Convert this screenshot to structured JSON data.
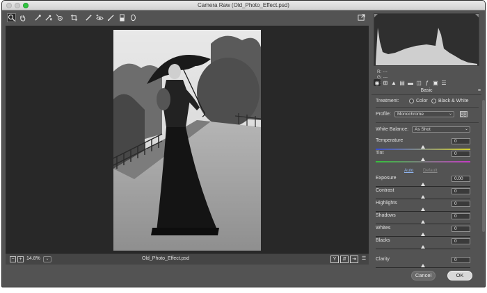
{
  "window": {
    "title": "Camera Raw (Old_Photo_Effect.psd)"
  },
  "toolbar": {
    "tools": [
      "zoom-icon",
      "hand-icon",
      "white-balance-icon",
      "color-sampler-icon",
      "targeted-adjustment-icon",
      "crop-icon",
      "spot-removal-icon",
      "red-eye-icon",
      "adjustment-brush-icon",
      "graduated-filter-icon",
      "radial-filter-icon"
    ],
    "fullscreen_icon": "fullscreen-toggle-icon"
  },
  "status": {
    "zoom": "14.8%",
    "filename": "Old_Photo_Effect.psd",
    "zoom_dropdown_icon": "chevron-down-icon"
  },
  "histogram": {
    "r_label": "R:",
    "r_value": "---",
    "g_label": "G:",
    "g_value": "---",
    "b_label": "B:",
    "b_value": "---"
  },
  "panel": {
    "title": "Basic",
    "treatment_label": "Treatment:",
    "treatment_color": "Color",
    "treatment_bw": "Black & White",
    "treatment_selected": "Black & White",
    "profile_label": "Profile:",
    "profile_value": "Monochrome",
    "wb_label": "White Balance:",
    "wb_value": "As Shot",
    "auto_label": "Auto",
    "default_label": "Default"
  },
  "sliders": [
    {
      "label": "Temperature",
      "value": "0",
      "position": 0.5,
      "track": "temperature"
    },
    {
      "label": "Tint",
      "value": "0",
      "position": 0.5,
      "track": "tint"
    },
    {
      "label": "Exposure",
      "value": "0.00",
      "position": 0.5
    },
    {
      "label": "Contrast",
      "value": "0",
      "position": 0.5
    },
    {
      "label": "Highlights",
      "value": "0",
      "position": 0.5
    },
    {
      "label": "Shadows",
      "value": "0",
      "position": 0.5
    },
    {
      "label": "Whites",
      "value": "0",
      "position": 0.5
    },
    {
      "label": "Blacks",
      "value": "0",
      "position": 0.5
    },
    {
      "label": "Clarity",
      "value": "0",
      "position": 0.5
    }
  ],
  "buttons": {
    "cancel": "Cancel",
    "ok": "OK"
  },
  "colors": {
    "panel_bg": "#535353",
    "canvas_bg": "#282828",
    "ok_bg": "#d8d8d8",
    "link_active": "#8fb4ee",
    "link_disabled": "#8a8a8a"
  }
}
